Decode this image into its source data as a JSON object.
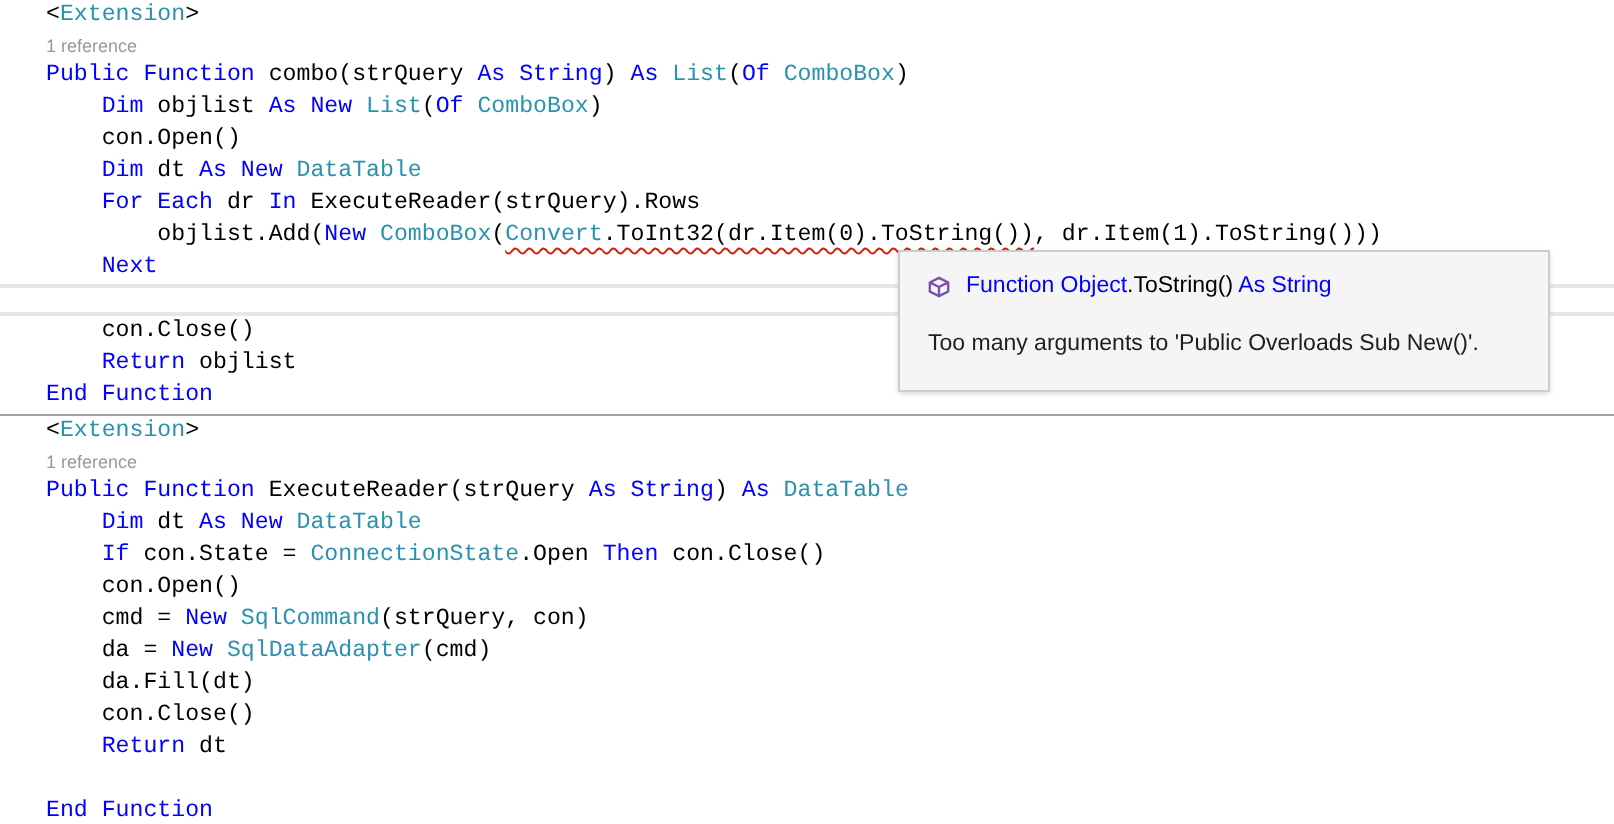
{
  "blocks": [
    {
      "lines": [
        {
          "kind": "code",
          "tokens": [
            {
              "text": "<",
              "kind": "plain"
            },
            {
              "text": "Extension",
              "kind": "type"
            },
            {
              "text": ">",
              "kind": "plain"
            }
          ]
        },
        {
          "kind": "reference",
          "text": "1 reference"
        },
        {
          "kind": "code",
          "tokens": [
            {
              "text": "Public Function",
              "kind": "kw"
            },
            {
              "text": " combo(strQuery ",
              "kind": "plain"
            },
            {
              "text": "As String",
              "kind": "kw"
            },
            {
              "text": ") ",
              "kind": "plain"
            },
            {
              "text": "As",
              "kind": "kw"
            },
            {
              "text": " List",
              "kind": "type"
            },
            {
              "text": "(",
              "kind": "plain"
            },
            {
              "text": "Of",
              "kind": "kw"
            },
            {
              "text": " ComboBox",
              "kind": "type"
            },
            {
              "text": ")",
              "kind": "plain"
            }
          ]
        },
        {
          "kind": "code",
          "tokens": [
            {
              "text": "    Dim",
              "kind": "kw"
            },
            {
              "text": " objlist ",
              "kind": "plain"
            },
            {
              "text": "As New",
              "kind": "kw"
            },
            {
              "text": " List",
              "kind": "type"
            },
            {
              "text": "(",
              "kind": "plain"
            },
            {
              "text": "Of",
              "kind": "kw"
            },
            {
              "text": " ComboBox",
              "kind": "type"
            },
            {
              "text": ")",
              "kind": "plain"
            }
          ]
        },
        {
          "kind": "code",
          "tokens": [
            {
              "text": "    con.Open()",
              "kind": "plain"
            }
          ]
        },
        {
          "kind": "code",
          "tokens": [
            {
              "text": "    Dim",
              "kind": "kw"
            },
            {
              "text": " dt ",
              "kind": "plain"
            },
            {
              "text": "As New",
              "kind": "kw"
            },
            {
              "text": " DataTable",
              "kind": "type"
            }
          ]
        },
        {
          "kind": "code",
          "tokens": [
            {
              "text": "    For Each",
              "kind": "kw"
            },
            {
              "text": " dr ",
              "kind": "plain"
            },
            {
              "text": "In",
              "kind": "kw"
            },
            {
              "text": " ExecuteReader(strQuery).Rows",
              "kind": "plain"
            }
          ]
        },
        {
          "kind": "code",
          "tokens": [
            {
              "text": "        objlist.Add(",
              "kind": "plain"
            },
            {
              "text": "New",
              "kind": "kw"
            },
            {
              "text": " ComboBox",
              "kind": "type"
            },
            {
              "text": "(",
              "kind": "plain"
            },
            {
              "text": "Convert",
              "kind": "type",
              "error": true
            },
            {
              "text": ".ToInt32(dr.Item(0).ToString())",
              "kind": "plain",
              "error": true
            },
            {
              "text": ", dr.Item(1).ToString()))",
              "kind": "plain",
              "error": false
            }
          ]
        },
        {
          "kind": "code",
          "tokens": [
            {
              "text": "    Next",
              "kind": "kw"
            }
          ]
        },
        {
          "kind": "blank",
          "current": true
        },
        {
          "kind": "code",
          "tokens": [
            {
              "text": "    con.Close()",
              "kind": "plain"
            }
          ]
        },
        {
          "kind": "code",
          "tokens": [
            {
              "text": "    Return",
              "kind": "kw"
            },
            {
              "text": " objlist",
              "kind": "plain"
            }
          ]
        },
        {
          "kind": "code",
          "tokens": [
            {
              "text": "End Function",
              "kind": "kw"
            }
          ]
        }
      ]
    },
    {
      "lines": [
        {
          "kind": "code",
          "tokens": [
            {
              "text": "<",
              "kind": "plain"
            },
            {
              "text": "Extension",
              "kind": "type"
            },
            {
              "text": ">",
              "kind": "plain"
            }
          ]
        },
        {
          "kind": "reference",
          "text": "1 reference"
        },
        {
          "kind": "code",
          "tokens": [
            {
              "text": "Public Function",
              "kind": "kw"
            },
            {
              "text": " ExecuteReader(strQuery ",
              "kind": "plain"
            },
            {
              "text": "As String",
              "kind": "kw"
            },
            {
              "text": ") ",
              "kind": "plain"
            },
            {
              "text": "As",
              "kind": "kw"
            },
            {
              "text": " DataTable",
              "kind": "type"
            }
          ]
        },
        {
          "kind": "code",
          "tokens": [
            {
              "text": "    Dim",
              "kind": "kw"
            },
            {
              "text": " dt ",
              "kind": "plain"
            },
            {
              "text": "As New",
              "kind": "kw"
            },
            {
              "text": " DataTable",
              "kind": "type"
            }
          ]
        },
        {
          "kind": "code",
          "tokens": [
            {
              "text": "    If",
              "kind": "kw"
            },
            {
              "text": " con.State = ",
              "kind": "plain"
            },
            {
              "text": "ConnectionState",
              "kind": "type"
            },
            {
              "text": ".Open ",
              "kind": "plain"
            },
            {
              "text": "Then",
              "kind": "kw"
            },
            {
              "text": " con.Close()",
              "kind": "plain"
            }
          ]
        },
        {
          "kind": "code",
          "tokens": [
            {
              "text": "    con.Open()",
              "kind": "plain"
            }
          ]
        },
        {
          "kind": "code",
          "tokens": [
            {
              "text": "    cmd = ",
              "kind": "plain"
            },
            {
              "text": "New",
              "kind": "kw"
            },
            {
              "text": " SqlCommand",
              "kind": "type"
            },
            {
              "text": "(strQuery, con)",
              "kind": "plain"
            }
          ]
        },
        {
          "kind": "code",
          "tokens": [
            {
              "text": "    da = ",
              "kind": "plain"
            },
            {
              "text": "New",
              "kind": "kw"
            },
            {
              "text": " SqlDataAdapter",
              "kind": "type"
            },
            {
              "text": "(cmd)",
              "kind": "plain"
            }
          ]
        },
        {
          "kind": "code",
          "tokens": [
            {
              "text": "    da.Fill(dt)",
              "kind": "plain"
            }
          ]
        },
        {
          "kind": "code",
          "tokens": [
            {
              "text": "    con.Close()",
              "kind": "plain"
            }
          ]
        },
        {
          "kind": "code",
          "tokens": [
            {
              "text": "    Return",
              "kind": "kw"
            },
            {
              "text": " dt",
              "kind": "plain"
            }
          ]
        },
        {
          "kind": "blank",
          "current": false
        },
        {
          "kind": "code",
          "tokens": [
            {
              "text": "End Function",
              "kind": "kw"
            }
          ]
        }
      ]
    }
  ],
  "tooltip": {
    "signature": [
      {
        "text": "Function Object",
        "kind": "kw"
      },
      {
        "text": ".ToString() ",
        "kind": "plain"
      },
      {
        "text": "As String",
        "kind": "kw"
      }
    ],
    "message": "Too many arguments to 'Public Overloads Sub New()'."
  }
}
